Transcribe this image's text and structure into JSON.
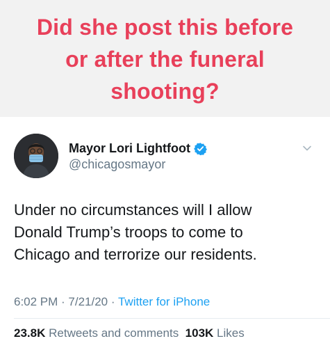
{
  "caption": {
    "line1": "Did she post this before",
    "line2": "or after the funeral",
    "line3": "shooting?"
  },
  "tweet": {
    "display_name": "Mayor Lori Lightfoot",
    "handle": "@chicagosmayor",
    "verified_icon": "verified-badge-icon",
    "menu_icon": "chevron-down-icon",
    "text_lines": [
      "Under no circumstances will I allow",
      "Donald Trump’s troops to come to",
      "Chicago and terrorize our residents."
    ],
    "time": "6:02 PM",
    "separator": " · ",
    "date": "7/21/20",
    "source": "Twitter for iPhone",
    "retweets_count": "23.8K",
    "retweets_label": "Retweets and comments",
    "likes_count": "103K",
    "likes_label": "Likes"
  },
  "colors": {
    "caption_text": "#e8405a",
    "caption_background": "#f2f2f2",
    "link_blue": "#1da1f2",
    "secondary_text": "#657786",
    "primary_text": "#14171a",
    "mask": "#8cc4e8"
  }
}
